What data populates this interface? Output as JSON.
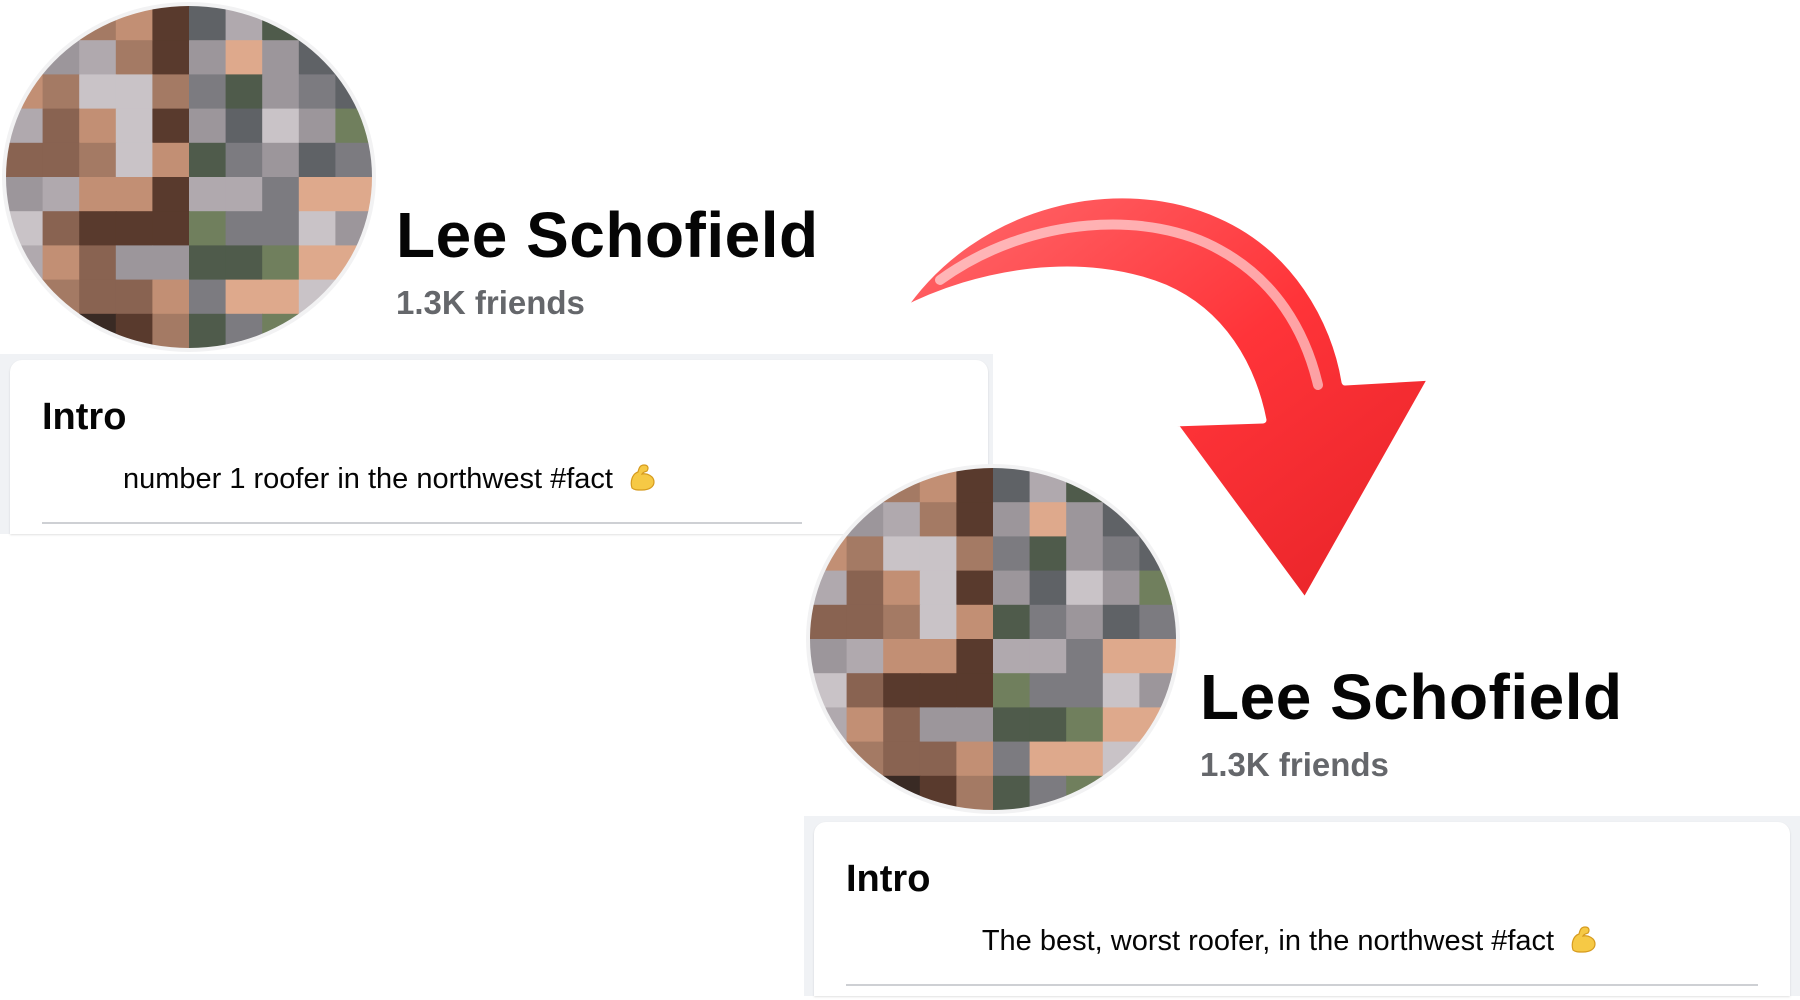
{
  "posts": [
    {
      "name": "Lee Schofield",
      "friends": "1.3K friends",
      "intro_title": "Intro",
      "bio": "number 1 roofer in the northwest #fact"
    },
    {
      "name": "Lee Schofield",
      "friends": "1.3K friends",
      "intro_title": "Intro",
      "bio": "The best, worst roofer, in the northwest #fact"
    }
  ],
  "icons": {
    "bio_emoji": "flexed-biceps-icon",
    "transition": "curved-arrow-icon"
  },
  "colors": {
    "name_text": "#050505",
    "friends_text": "#65676b",
    "card_strip": "#f0f2f5",
    "divider": "#ced0d4",
    "arrow_red": "#ff3b3f",
    "emoji_yellow": "#f6c945"
  }
}
